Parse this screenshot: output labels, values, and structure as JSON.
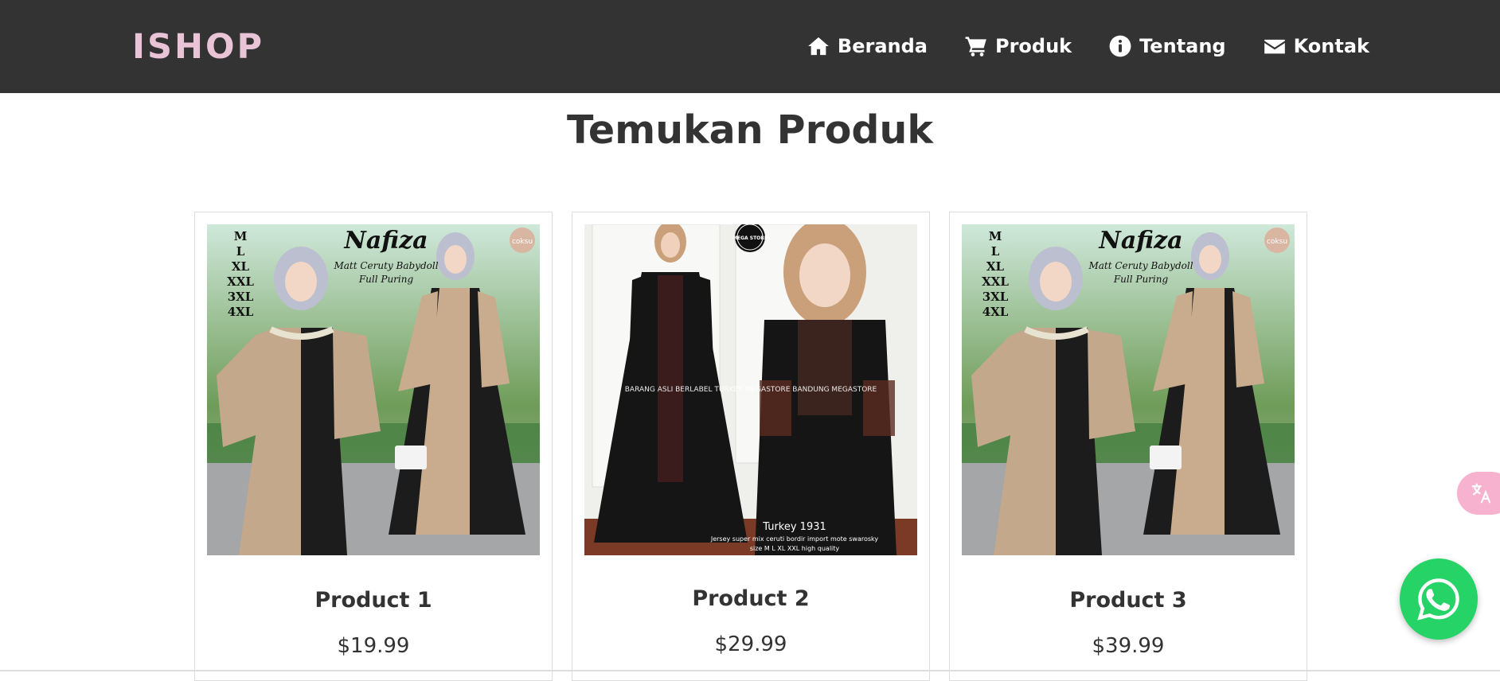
{
  "brand": "ISHOP",
  "nav": [
    {
      "label": "Beranda",
      "icon": "home-icon"
    },
    {
      "label": "Produk",
      "icon": "cart-icon"
    },
    {
      "label": "Tentang",
      "icon": "info-icon"
    },
    {
      "label": "Kontak",
      "icon": "envelope-icon"
    }
  ],
  "section_title": "Temukan Produk",
  "products": [
    {
      "name": "Product 1",
      "price": "$19.99",
      "image": {
        "brand": "Nafiza",
        "subtitle1": "Matt Ceruty Babydoll",
        "subtitle2": "Full Puring",
        "sizes": [
          "M",
          "L",
          "XL",
          "XXL",
          "3XL",
          "4XL"
        ],
        "badge": "coksu"
      }
    },
    {
      "name": "Product 2",
      "price": "$29.99",
      "image": {
        "badge": "MEGA STORE",
        "watermark": "BARANG ASLI BERLABEL TURKEY MEGASTORE BANDUNG MEGASTORE",
        "caption": "Turkey 1931",
        "desc1": "Jersey super mix ceruti bordir import mote swarosky",
        "desc2": "size M L XL XXL high quality"
      }
    },
    {
      "name": "Product 3",
      "price": "$39.99",
      "image": {
        "brand": "Nafiza",
        "subtitle1": "Matt Ceruty Babydoll",
        "subtitle2": "Full Puring",
        "sizes": [
          "M",
          "L",
          "XL",
          "XXL",
          "3XL",
          "4XL"
        ],
        "badge": "coksu"
      }
    }
  ],
  "translate_icon": "translate-icon",
  "whatsapp_icon": "whatsapp-icon",
  "colors": {
    "navbar": "#333333",
    "brand": "#e9c3d6",
    "text": "#333333",
    "whatsapp": "#25d366",
    "translate": "#f7b2cf"
  }
}
